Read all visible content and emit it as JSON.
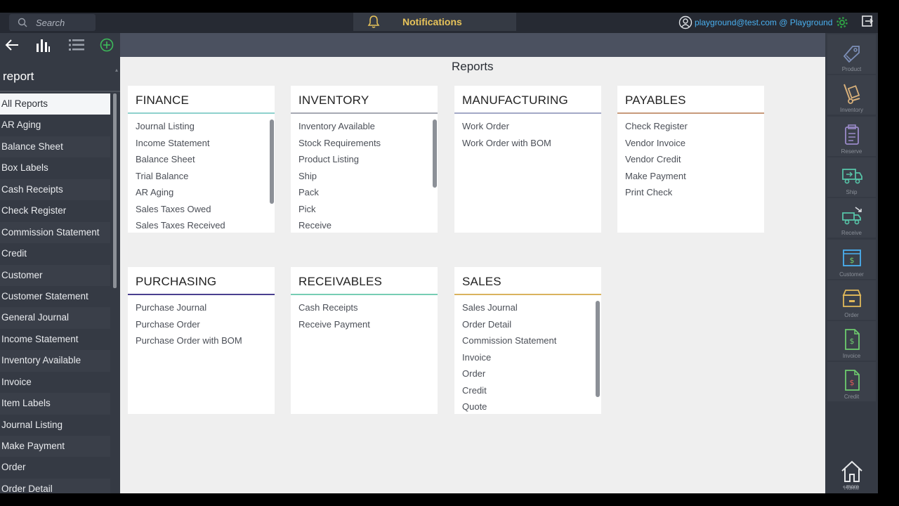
{
  "topbar": {
    "search_placeholder": "Search",
    "notifications_label": "Notifications",
    "user_label": "playground@test.com @ Playground"
  },
  "sidebar": {
    "filter_value": "report",
    "items": [
      "All Reports",
      "AR Aging",
      "Balance Sheet",
      "Box Labels",
      "Cash Receipts",
      "Check Register",
      "Commission Statement",
      "Credit",
      "Customer",
      "Customer Statement",
      "General Journal",
      "Income Statement",
      "Inventory Available",
      "Invoice",
      "Item Labels",
      "Journal Listing",
      "Make Payment",
      "Order",
      "Order Detail"
    ],
    "active_item": "All Reports"
  },
  "main": {
    "title": "Reports",
    "cards": [
      {
        "title": "FINANCE",
        "color": "#8fd1cd",
        "items": [
          "Journal Listing",
          "Income Statement",
          "Balance Sheet",
          "Trial Balance",
          "AR Aging",
          "Sales Taxes Owed",
          "Sales Taxes Received"
        ]
      },
      {
        "title": "INVENTORY",
        "color": "#a6a9b3",
        "items": [
          "Inventory Available",
          "Stock Requirements",
          "Product Listing",
          "Ship",
          "Pack",
          "Pick",
          "Receive"
        ]
      },
      {
        "title": "MANUFACTURING",
        "color": "#a3a8c6",
        "items": [
          "Work Order",
          "Work Order with BOM"
        ]
      },
      {
        "title": "PAYABLES",
        "color": "#c79a7b",
        "items": [
          "Check Register",
          "Vendor Invoice",
          "Vendor Credit",
          "Make Payment",
          "Print Check"
        ]
      },
      {
        "title": "PURCHASING",
        "color": "#4a3f8f",
        "items": [
          "Purchase Journal",
          "Purchase Order",
          "Purchase Order with BOM"
        ]
      },
      {
        "title": "RECEIVABLES",
        "color": "#77cdb4",
        "items": [
          "Cash Receipts",
          "Receive Payment"
        ]
      },
      {
        "title": "SALES",
        "color": "#d9b35e",
        "items": [
          "Sales Journal",
          "Order Detail",
          "Commission Statement",
          "Invoice",
          "Order",
          "Credit",
          "Quote"
        ]
      }
    ]
  },
  "rightbar": {
    "buttons": [
      {
        "label": "Product",
        "icon": "product-tag-icon",
        "color": "#7d8fb8"
      },
      {
        "label": "Inventory",
        "icon": "inventory-hand-truck-icon",
        "color": "#d8b07a"
      },
      {
        "label": "Reserve",
        "icon": "reserve-clipboard-icon",
        "color": "#9a8ac9"
      },
      {
        "label": "Ship",
        "icon": "ship-truck-icon",
        "color": "#57c4a8"
      },
      {
        "label": "Receive",
        "icon": "receive-truck-icon",
        "color": "#57c4a8"
      },
      {
        "label": "Customer",
        "icon": "customer-box-icon",
        "color": "#4ab0f0"
      },
      {
        "label": "Order",
        "icon": "order-box-icon",
        "color": "#e0b85a"
      },
      {
        "label": "Invoice",
        "icon": "invoice-document-icon",
        "color": "#6ecb6e"
      },
      {
        "label": "Credit",
        "icon": "credit-document-icon",
        "color": "#6ecb6e"
      }
    ],
    "home_label": "Home",
    "more_label": "‹ more"
  }
}
